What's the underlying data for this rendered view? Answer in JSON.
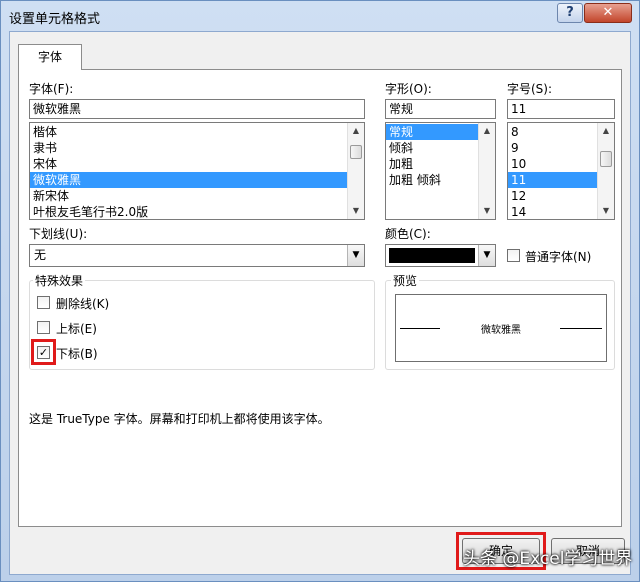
{
  "window": {
    "title": "设置单元格格式"
  },
  "titlebar": {
    "help_glyph": "?",
    "close_glyph": "✕"
  },
  "tabs": [
    {
      "label": "字体",
      "active": true
    }
  ],
  "font": {
    "label": "字体(F):",
    "value": "微软雅黑",
    "items": [
      "楷体",
      "隶书",
      "宋体",
      "微软雅黑",
      "新宋体",
      "叶根友毛笔行书2.0版"
    ],
    "selected_index": 3
  },
  "style": {
    "label": "字形(O):",
    "value": "常规",
    "items": [
      "常规",
      "倾斜",
      "加粗",
      "加粗 倾斜"
    ],
    "selected_index": 0
  },
  "size": {
    "label": "字号(S):",
    "value": "11",
    "items": [
      "8",
      "9",
      "10",
      "11",
      "12",
      "14"
    ],
    "selected_index": 3
  },
  "underline": {
    "label": "下划线(U):",
    "value": "无"
  },
  "color": {
    "label": "颜色(C):",
    "value": "#000000",
    "normal_font_label": "普通字体(N)",
    "normal_font_checked": false
  },
  "effects": {
    "title": "特殊效果",
    "items": [
      {
        "label": "删除线(K)",
        "checked": false
      },
      {
        "label": "上标(E)",
        "checked": false
      },
      {
        "label": "下标(B)",
        "checked": true
      }
    ]
  },
  "preview": {
    "title": "预览",
    "sample": "微软雅黑"
  },
  "info_text": "这是 TrueType 字体。屏幕和打印机上都将使用该字体。",
  "buttons": {
    "ok": "确定",
    "cancel": "取消"
  },
  "watermark": "头条 @Excel学习世界",
  "icons": {
    "scroll_up": "▲",
    "scroll_down": "▼",
    "dropdown": "▼",
    "check": "✓"
  },
  "colors": {
    "selection": "#3399ff",
    "highlight_frame": "#e01a1a",
    "close_button": "#c2452b"
  }
}
